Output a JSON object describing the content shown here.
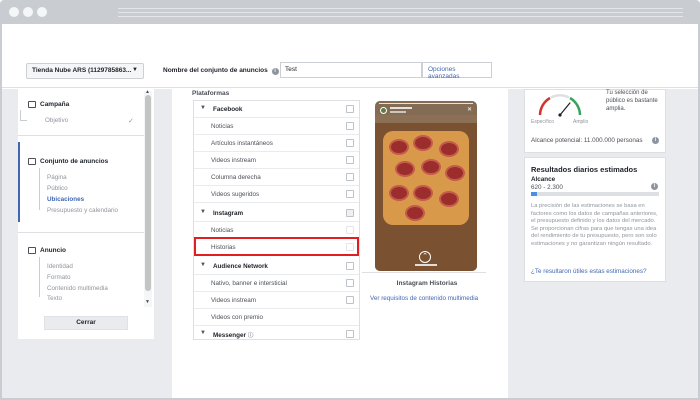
{
  "account": {
    "label": "Tienda Nube ARS (1129785863...",
    "caret": "▼"
  },
  "adset": {
    "label": "Nombre del conjunto de anuncios",
    "info": "i",
    "value": "Test",
    "advanced_label": "Opciones avanzadas"
  },
  "sidebar": {
    "campaign": {
      "title": "Campaña",
      "items": [
        "Objetivo"
      ],
      "check": "✓"
    },
    "adset": {
      "title": "Conjunto de anuncios",
      "items": [
        "Página",
        "Público",
        "Ubicaciones",
        "Presupuesto y calendario"
      ]
    },
    "ad": {
      "title": "Anuncio",
      "items": [
        "Identidad",
        "Formato",
        "Contenido multimedia",
        "Texto"
      ]
    },
    "close_label": "Cerrar"
  },
  "platforms": {
    "title": "Plataformas",
    "groups": [
      {
        "name": "Facebook",
        "items": [
          "Noticias",
          "Artículos instantáneos",
          "Videos instream",
          "Columna derecha",
          "Videos sugeridos"
        ]
      },
      {
        "name": "Instagram",
        "items": [
          "Noticias",
          "Historias"
        ]
      },
      {
        "name": "Audience Network",
        "items": [
          "Nativo, banner e intersticial",
          "Videos instream",
          "Videos con premio"
        ]
      },
      {
        "name": "Messenger",
        "items": []
      }
    ]
  },
  "preview": {
    "label": "Instagram Historias",
    "link": "Ver requisitos de contenido multimedia"
  },
  "audience": {
    "gauge_left": "Específico",
    "gauge_right": "Amplio",
    "gauge_level": 0.72,
    "description": "Tu selección de público es bastante amplia.",
    "potential": "Alcance potencial: 11.000.000 personas"
  },
  "results": {
    "title": "Resultados diarios estimados",
    "reach_label": "Alcance",
    "reach_value": "620 - 2.300",
    "reach_level": 0.05,
    "description": "La precisión de las estimaciones se basa en factores como los datos de campañas anteriores, el presupuesto definido y los datos del mercado. Se proporcionan cifras para que tengas una idea del rendimiento de tu presupuesto, pero son solo estimaciones y no garantizan ningún resultado.",
    "link": "¿Te resultaron útiles estas estimaciones?"
  },
  "icons": {
    "info": "info-icon",
    "chevron": "chevron-down-icon",
    "checkbox": "checkbox-icon"
  },
  "colors": {
    "accent": "#4267b2",
    "highlight": "#e02020",
    "gauge_red": "#d0342c",
    "gauge_green": "#3aa25b"
  }
}
